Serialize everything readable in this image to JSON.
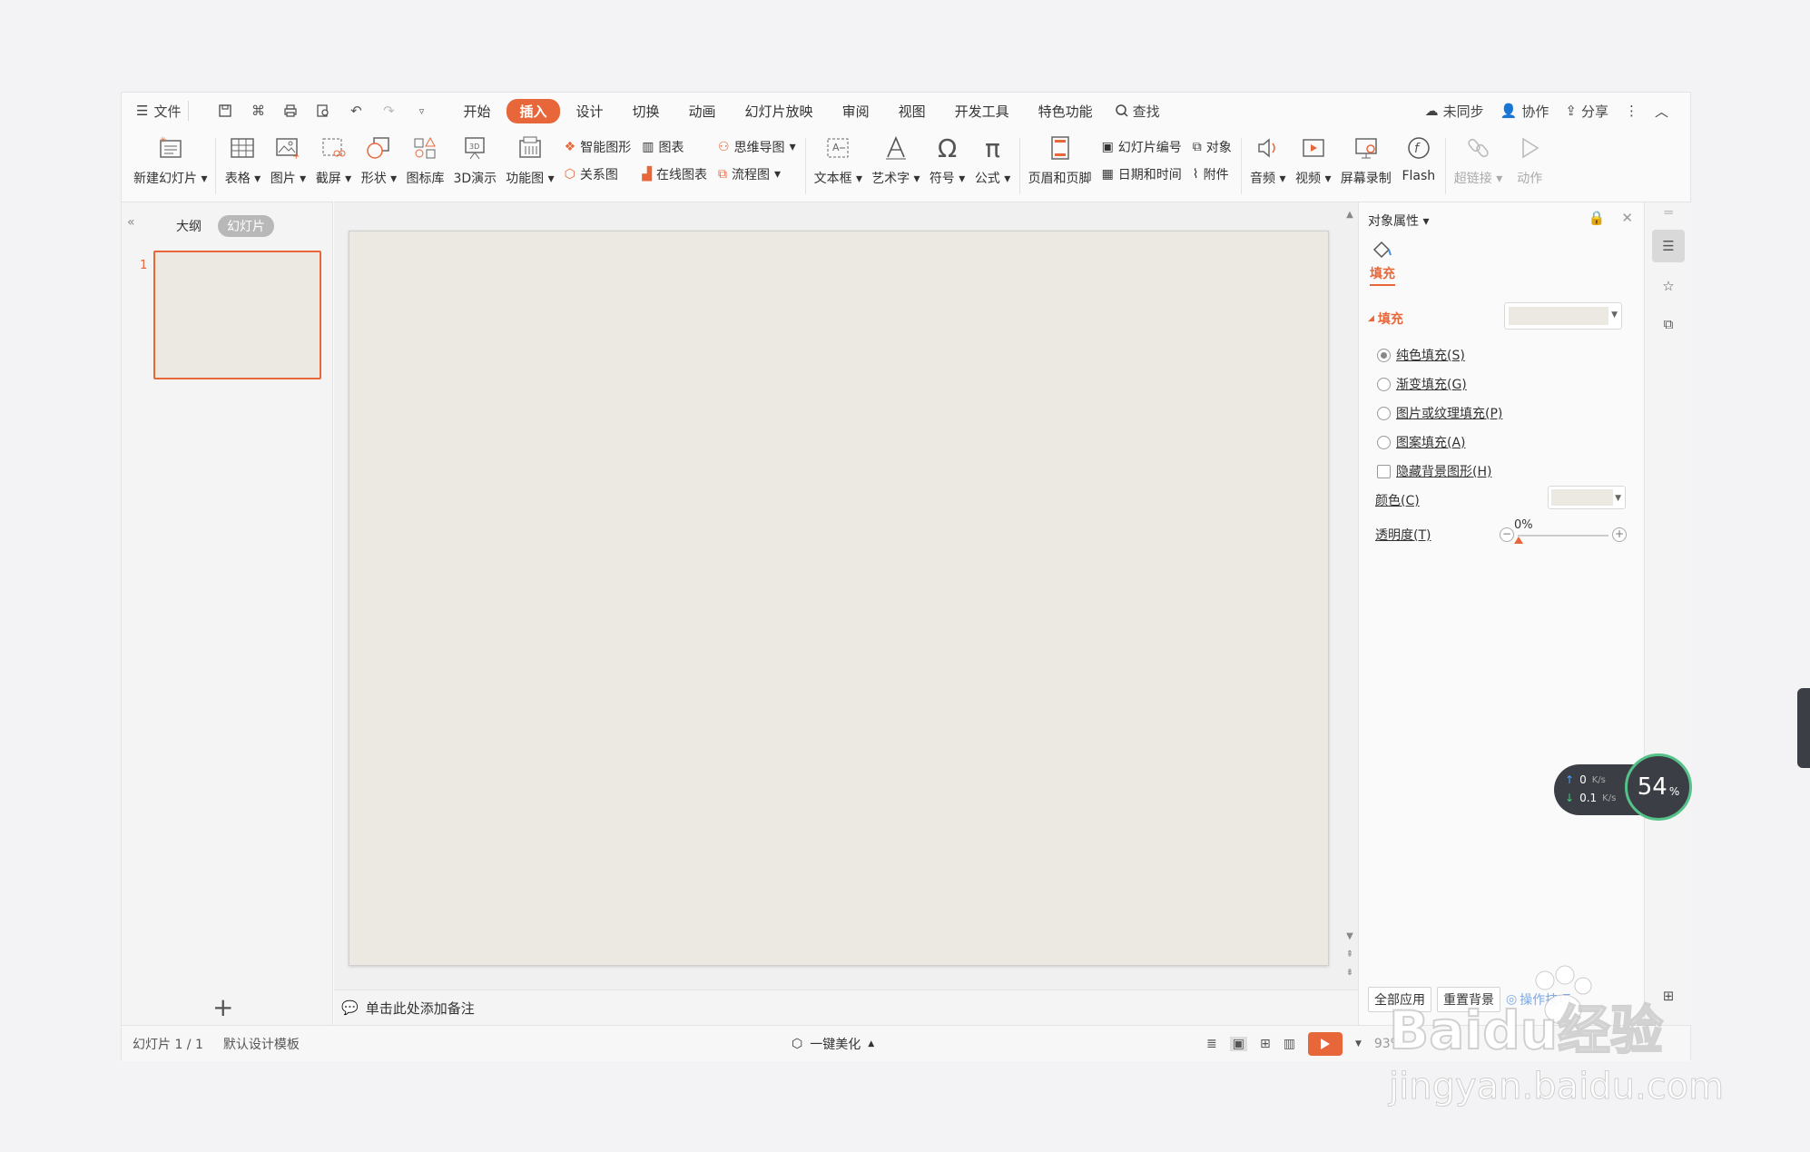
{
  "menubar": {
    "file_label": "文件",
    "tabs": [
      {
        "label": "开始",
        "active": false
      },
      {
        "label": "插入",
        "active": true
      },
      {
        "label": "设计",
        "active": false
      },
      {
        "label": "切换",
        "active": false
      },
      {
        "label": "动画",
        "active": false
      },
      {
        "label": "幻灯片放映",
        "active": false
      },
      {
        "label": "审阅",
        "active": false
      },
      {
        "label": "视图",
        "active": false
      },
      {
        "label": "开发工具",
        "active": false
      },
      {
        "label": "特色功能",
        "active": false
      }
    ],
    "search_label": "查找",
    "sync_label": "未同步",
    "collab_label": "协作",
    "share_label": "分享"
  },
  "ribbon": {
    "new_slide": "新建幻灯片",
    "table": "表格",
    "picture": "图片",
    "screenshot": "截屏",
    "shape": "形状",
    "icon_lib": "图标库",
    "demo_3d": "3D演示",
    "func_chart": "功能图",
    "smart_art": "智能图形",
    "chart": "图表",
    "relation": "关系图",
    "online_chart": "在线图表",
    "mindmap": "思维导图",
    "flowchart": "流程图",
    "textbox": "文本框",
    "wordart": "艺术字",
    "symbol": "符号",
    "formula": "公式",
    "header_footer": "页眉和页脚",
    "slide_number": "幻灯片编号",
    "datetime": "日期和时间",
    "object": "对象",
    "attachment": "附件",
    "audio": "音频",
    "video": "视频",
    "screen_record": "屏幕录制",
    "flash": "Flash",
    "hyperlink": "超链接",
    "action": "动作"
  },
  "left_panel": {
    "outline_tab": "大纲",
    "slides_tab": "幻灯片",
    "slide_number": "1"
  },
  "notes_placeholder": "单击此处添加备注",
  "props": {
    "title": "对象属性",
    "fill_tab": "填充",
    "fill_section": "填充",
    "options": [
      {
        "label": "纯色填充(S)",
        "type": "radio",
        "checked": true
      },
      {
        "label": "渐变填充(G)",
        "type": "radio",
        "checked": false
      },
      {
        "label": "图片或纹理填充(P)",
        "type": "radio",
        "checked": false
      },
      {
        "label": "图案填充(A)",
        "type": "radio",
        "checked": false
      },
      {
        "label": "隐藏背景图形(H)",
        "type": "checkbox",
        "checked": false
      }
    ],
    "color_label": "颜色(C)",
    "transparency_label": "透明度(T)",
    "transparency_value": "0%",
    "transparency_fraction": 0,
    "apply_all": "全部应用",
    "reset_bg": "重置背景",
    "tips": "操作技巧",
    "fill_color": "#ebe9e1"
  },
  "status": {
    "slide_pos": "幻灯片 1 / 1",
    "template": "默认设计模板",
    "beautify": "一键美化",
    "zoom": "93%"
  },
  "net_widget": {
    "up": "0",
    "down": "0.1",
    "unit": "K/s",
    "percent": "54",
    "percent_sign": "%"
  },
  "watermark": {
    "brand": "Baidu经验",
    "url": "jingyan.baidu.com"
  },
  "colors": {
    "accent": "#e8673a",
    "slide_bg": "#ebe9e1"
  }
}
